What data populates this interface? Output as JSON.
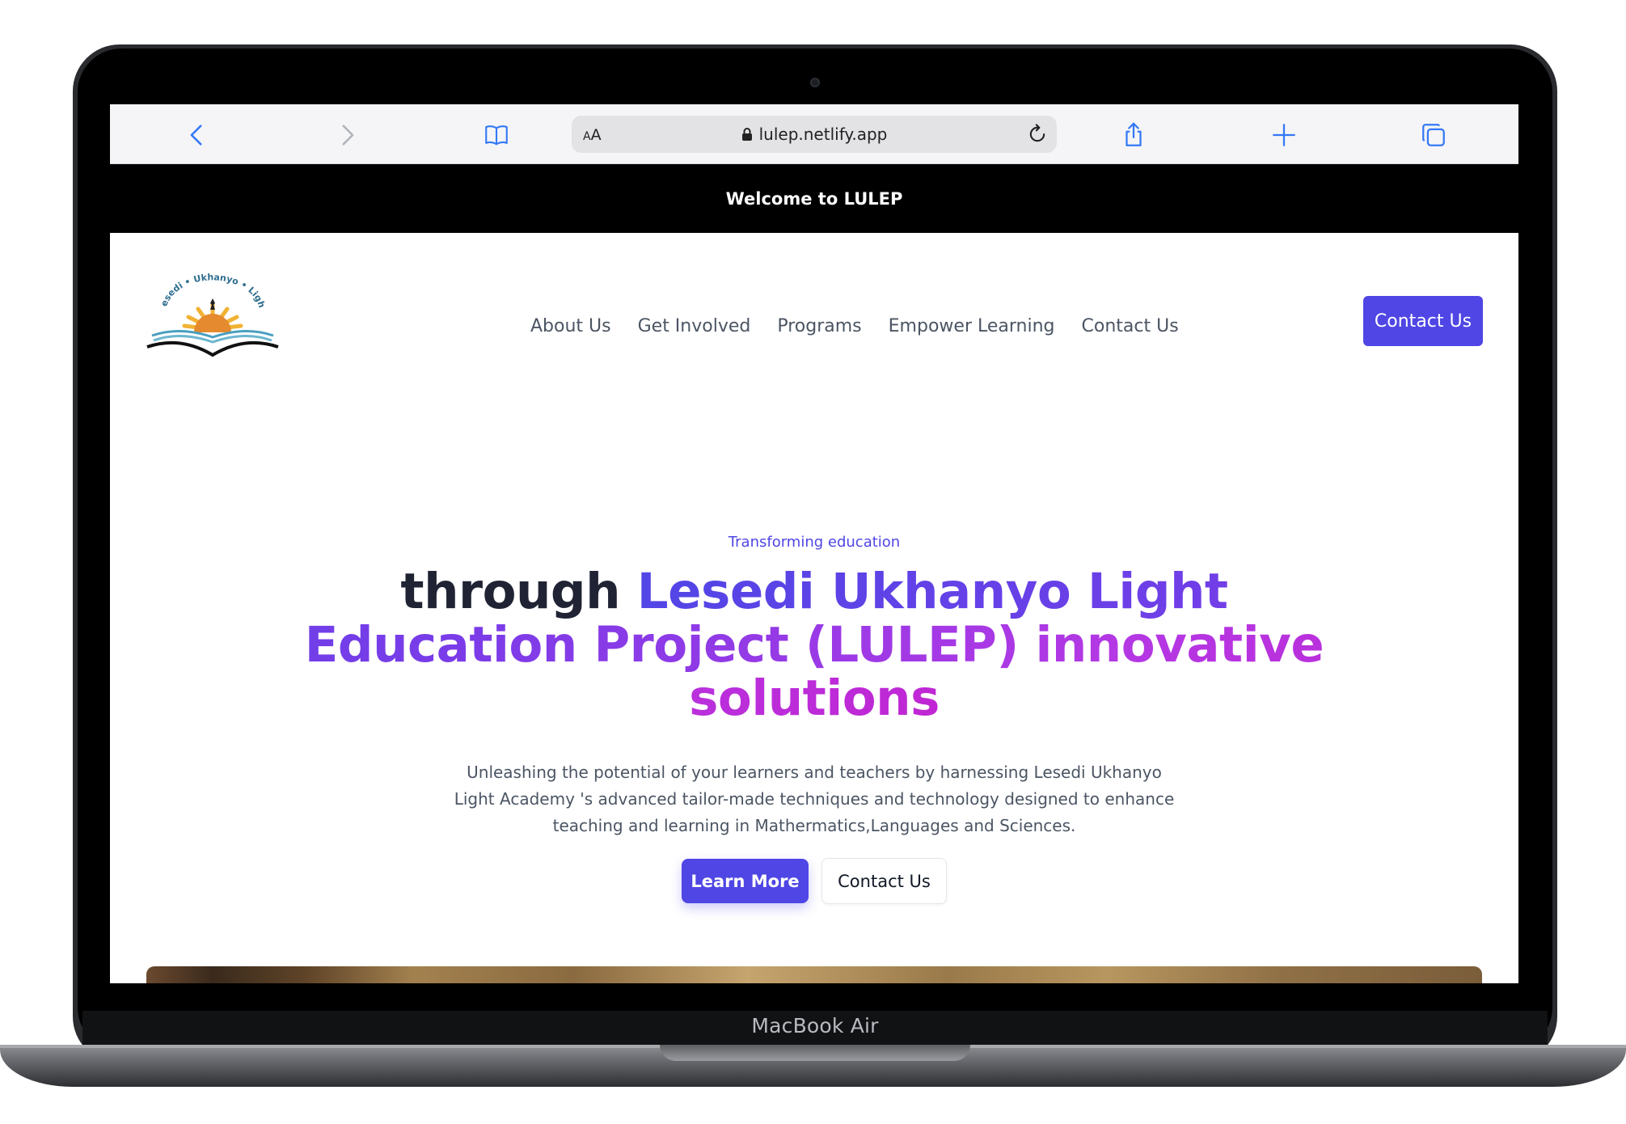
{
  "device": {
    "label": "MacBook Air"
  },
  "browser": {
    "address_text_size_label": "AA",
    "url": "lulep.netlify.app",
    "toolbar_icons": [
      "back-icon",
      "forward-icon",
      "bookmarks-icon",
      "lock-icon",
      "reload-icon",
      "share-icon",
      "new-tab-icon",
      "tabs-icon"
    ]
  },
  "announcement": {
    "text": "Welcome to LULEP"
  },
  "header": {
    "logo_text": "Lesedi • Ukhanyo • Light",
    "nav": [
      {
        "label": "About Us"
      },
      {
        "label": "Get Involved"
      },
      {
        "label": "Programs"
      },
      {
        "label": "Empower Learning"
      },
      {
        "label": "Contact Us"
      }
    ],
    "cta_label": "Contact Us"
  },
  "hero": {
    "eyebrow": "Transforming education",
    "title_dark": "through",
    "title_gradient": "Lesedi Ukhanyo Light Education Project (LULEP) innovative solutions",
    "subtitle": "Unleashing the potential of your learners and teachers by harnessing Lesedi Ukhanyo Light Academy 's advanced tailor-made techniques and technology designed to enhance teaching and learning in Mathermatics,Languages and Sciences.",
    "primary_button": "Learn More",
    "secondary_button": "Contact Us"
  },
  "colors": {
    "accent": "#4f46e5",
    "gradient_end": "#c026d3",
    "heading_dark": "#1f2333",
    "announcement_bg": "#000000",
    "safari_blue": "#3478f6"
  }
}
